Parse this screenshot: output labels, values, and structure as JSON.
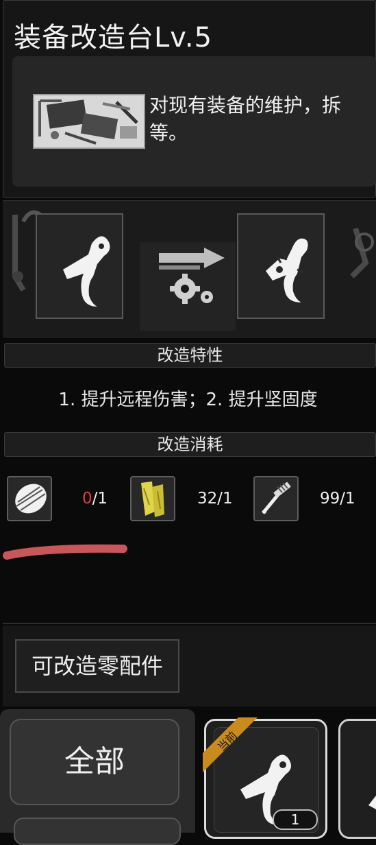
{
  "header": {
    "title": "装备改造台Lv.5",
    "description": "对现有装备的维护，拆",
    "description_line2": "等。"
  },
  "conversion": {
    "from_icon": "trigger-part-icon",
    "to_icon": "upgraded-trigger-part-icon",
    "arrow_icon": "arrow-right-icon",
    "gear_icon": "gears-icon"
  },
  "traits": {
    "heading": "改造特性",
    "text": "1. 提升远程伤害；2. 提升坚固度"
  },
  "cost": {
    "heading": "改造消耗",
    "materials": [
      {
        "icon": "wrapped-bone-icon",
        "have": "0",
        "need": "/1"
      },
      {
        "icon": "yellow-plank-icon",
        "have": "32",
        "need": "/1"
      },
      {
        "icon": "spring-tool-icon",
        "have": "99",
        "need": "/1"
      }
    ]
  },
  "parts": {
    "button_label": "可改造零配件"
  },
  "filter": {
    "all_label": "全部"
  },
  "inventory": {
    "current_badge": "当前",
    "current_qty": "1"
  },
  "colors": {
    "insufficient": "#e53935",
    "badge": "#c98a1e",
    "scribble": "#c7575b"
  }
}
